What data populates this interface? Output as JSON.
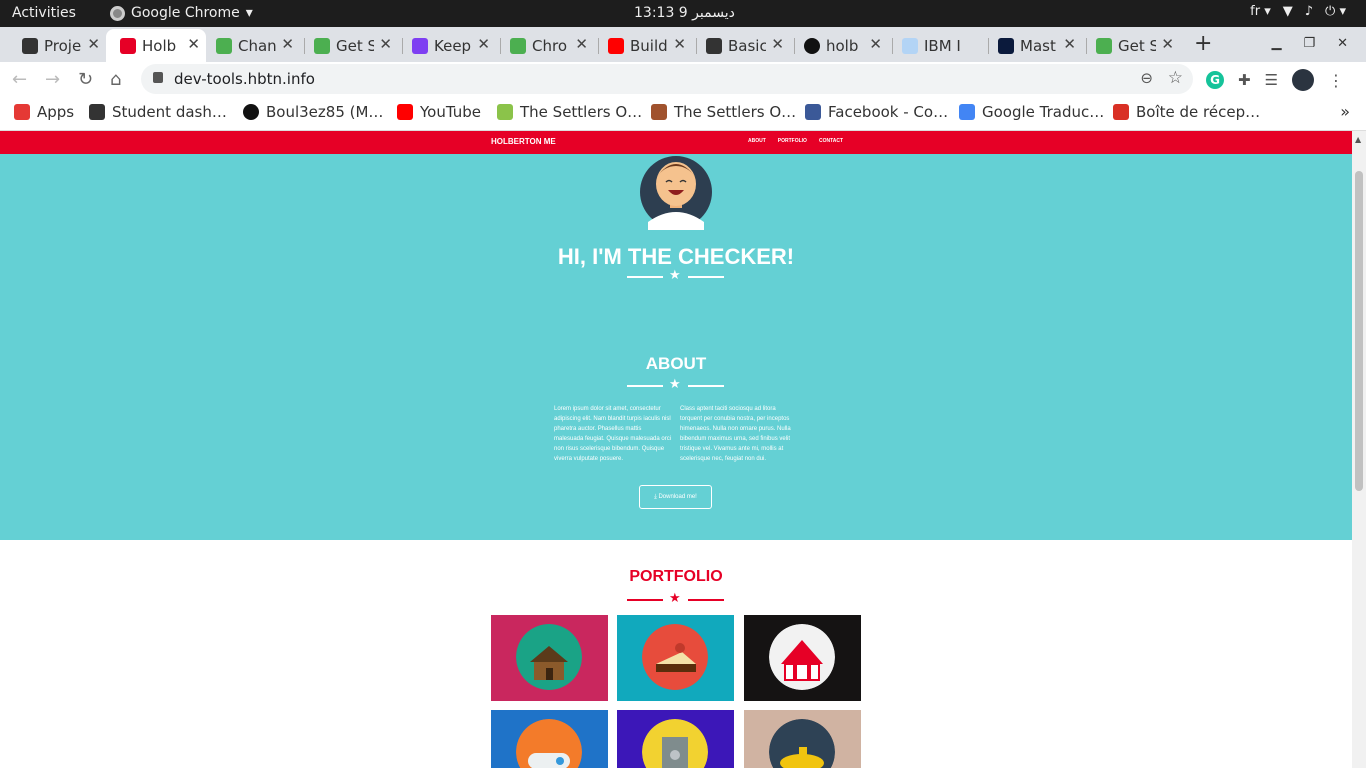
{
  "system": {
    "activities": "Activities",
    "app_name": "Google Chrome",
    "clock": "13:13  9 ديسمبر",
    "lang": "fr"
  },
  "tabs": [
    {
      "label": "Proje",
      "color": "#333333"
    },
    {
      "label": "Holb",
      "color": "#e60026",
      "active": true
    },
    {
      "label": "Chan",
      "color": "#4caf50"
    },
    {
      "label": "Get S",
      "color": "#4caf50"
    },
    {
      "label": "Keep",
      "color": "#7e3ff2"
    },
    {
      "label": "Chro",
      "color": "#4caf50"
    },
    {
      "label": "Build",
      "color": "#ff0000"
    },
    {
      "label": "Basic",
      "color": "#333333"
    },
    {
      "label": "holb",
      "color": "#111111"
    },
    {
      "label": "IBM I",
      "color": "#b3d4f5"
    },
    {
      "label": "Mast",
      "color": "#0b1a3c"
    },
    {
      "label": "Get S",
      "color": "#4caf50"
    }
  ],
  "toolbar": {
    "url": "dev-tools.hbtn.info",
    "grammarly": "G"
  },
  "bookmarks": [
    {
      "label": "Apps",
      "color": "#e53935"
    },
    {
      "label": "Student dash…",
      "color": "#333333"
    },
    {
      "label": "Boul3ez85 (M…",
      "color": "#111111"
    },
    {
      "label": "YouTube",
      "color": "#ff0000"
    },
    {
      "label": "The Settlers O…",
      "color": "#8bc34a"
    },
    {
      "label": "The Settlers O…",
      "color": "#a0522d"
    },
    {
      "label": "Facebook - Co…",
      "color": "#3b5998"
    },
    {
      "label": "Google Traduc…",
      "color": "#4285f4"
    },
    {
      "label": "Boîte de récep…",
      "color": "#d93025"
    }
  ],
  "site": {
    "brand": "HOLBERTON ME",
    "nav": [
      "ABOUT",
      "PORTFOLIO",
      "CONTACT"
    ],
    "hero_title": "HI, I'M THE CHECKER!",
    "about_title": "ABOUT",
    "about_left": "Lorem ipsum dolor sit amet, consectetur adipiscing elit. Nam blandit turpis iaculis nisl pharetra auctor. Phasellus mattis malesuada feugiat. Quisque malesuada orci non risus scelerisque bibendum. Quisque viverra vulputate posuere.",
    "about_right": "Class aptent taciti sociosqu ad litora torquent per conubia nostra, per inceptos himenaeos. Nulla non ornare purus. Nulla bibendum maximus urna, sed finibus velit tristique vel. Vivamus ante mi, mollis at scelerisque nec, feugiat non dui.",
    "download": "⤓ Download me!",
    "portfolio_title": "PORTFOLIO",
    "colors": {
      "red": "#e60026",
      "teal": "#64d0d4"
    },
    "portfolio": [
      {
        "name": "cabin",
        "bg": "#c9275e",
        "circle": "#1aa386"
      },
      {
        "name": "cake",
        "bg": "#11a9bd",
        "circle": "#e74c3c"
      },
      {
        "name": "circus-tent",
        "bg": "#151313",
        "circle": "#f2f2f2"
      },
      {
        "name": "game-controller",
        "bg": "#1f73c8",
        "circle": "#f37b2a"
      },
      {
        "name": "safe",
        "bg": "#3c17b8",
        "circle": "#f2d230"
      },
      {
        "name": "submarine",
        "bg": "#d0b3a2",
        "circle": "#2e4255"
      }
    ]
  }
}
